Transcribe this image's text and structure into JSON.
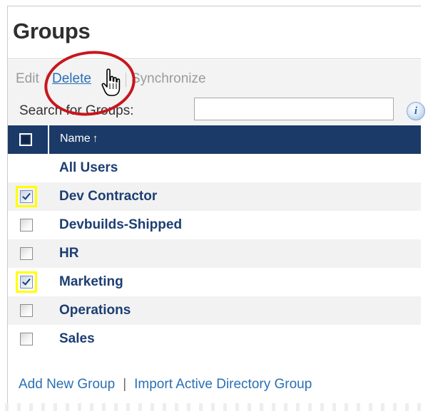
{
  "panel": {
    "title": "Groups"
  },
  "toolbar": {
    "edit_label": "Edit",
    "delete_label": "Delete",
    "synchronize_label": "Synchronize"
  },
  "search": {
    "label": "Search for Groups:",
    "value": "",
    "info_icon": "i"
  },
  "table": {
    "column_name": "Name",
    "sort_indicator": "↑",
    "rows": [
      {
        "name": "All Users",
        "checked": false,
        "has_checkbox": false,
        "highlighted": false
      },
      {
        "name": "Dev Contractor",
        "checked": true,
        "has_checkbox": true,
        "highlighted": true
      },
      {
        "name": "Devbuilds-Shipped",
        "checked": false,
        "has_checkbox": true,
        "highlighted": false
      },
      {
        "name": "HR",
        "checked": false,
        "has_checkbox": true,
        "highlighted": false
      },
      {
        "name": "Marketing",
        "checked": true,
        "has_checkbox": true,
        "highlighted": true
      },
      {
        "name": "Operations",
        "checked": false,
        "has_checkbox": true,
        "highlighted": false
      },
      {
        "name": "Sales",
        "checked": false,
        "has_checkbox": true,
        "highlighted": false
      }
    ]
  },
  "footer": {
    "add_new_group": "Add New Group",
    "separator": "|",
    "import_ad_group": "Import Active Directory Group"
  },
  "colors": {
    "header_bg": "#1b3a67",
    "link": "#2a6fb5",
    "group_name": "#1d3e73",
    "highlight": "#ffff00",
    "callout": "#c8161d"
  },
  "icons": {
    "cursor": "hand-pointer-icon",
    "info": "info-icon",
    "sort": "sort-ascending-icon"
  }
}
